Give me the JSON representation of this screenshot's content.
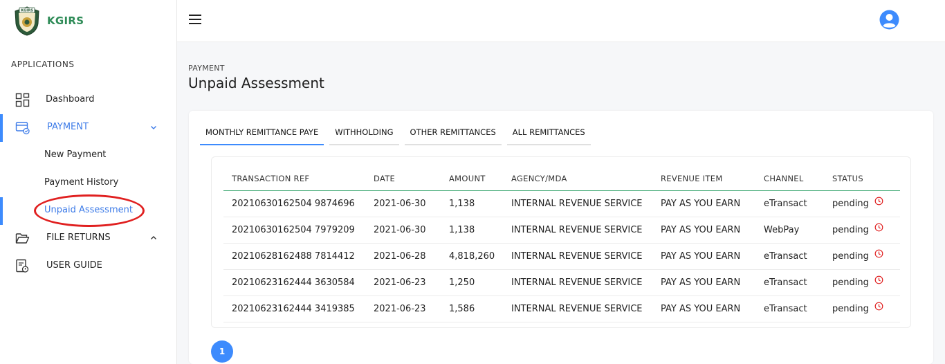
{
  "brand": {
    "name": "KGIRS",
    "logo_text": "KGIRS",
    "accent": "#2e8b57"
  },
  "sidebar": {
    "section_label": "APPLICATIONS",
    "items": [
      {
        "label": "Dashboard",
        "icon": "dashboard-grid-icon"
      },
      {
        "label": "PAYMENT",
        "icon": "payment-card-icon",
        "expanded": true
      },
      {
        "label": "FILE RETURNS",
        "icon": "folder-open-icon",
        "expanded": false
      },
      {
        "label": "USER GUIDE",
        "icon": "user-guide-icon"
      }
    ],
    "payment_sub": [
      {
        "label": "New Payment"
      },
      {
        "label": "Payment History"
      },
      {
        "label": "Unpaid Assessment",
        "active": true
      }
    ]
  },
  "header": {
    "menu_icon": "hamburger-icon",
    "avatar_icon": "user-avatar-icon"
  },
  "main": {
    "breadcrumb": "PAYMENT",
    "title": "Unpaid Assessment",
    "tabs": [
      {
        "label": "MONTHLY REMITTANCE PAYE",
        "active": true
      },
      {
        "label": "WITHHOLDING"
      },
      {
        "label": "OTHER REMITTANCES"
      },
      {
        "label": "ALL REMITTANCES"
      }
    ],
    "table": {
      "columns": [
        "TRANSACTION REF",
        "DATE",
        "AMOUNT",
        "AGENCY/MDA",
        "REVENUE ITEM",
        "CHANNEL",
        "STATUS"
      ],
      "rows": [
        [
          "20210630162504 9874696",
          "2021-06-30",
          "1,138",
          "INTERNAL REVENUE SERVICE",
          "PAY AS YOU EARN",
          "eTransact",
          "pending"
        ],
        [
          "20210630162504 7979209",
          "2021-06-30",
          "1,138",
          "INTERNAL REVENUE SERVICE",
          "PAY AS YOU EARN",
          "WebPay",
          "pending"
        ],
        [
          "20210628162488 7814412",
          "2021-06-28",
          "4,818,260",
          "INTERNAL REVENUE SERVICE",
          "PAY AS YOU EARN",
          "eTransact",
          "pending"
        ],
        [
          "20210623162444 3630584",
          "2021-06-23",
          "1,250",
          "INTERNAL REVENUE SERVICE",
          "PAY AS YOU EARN",
          "eTransact",
          "pending"
        ],
        [
          "20210623162444 3419385",
          "2021-06-23",
          "1,586",
          "INTERNAL REVENUE SERVICE",
          "PAY AS YOU EARN",
          "eTransact",
          "pending"
        ]
      ]
    },
    "pagination": {
      "current_page": "1"
    }
  },
  "colors": {
    "active_blue": "#3d8bfd",
    "status_icon": "#e02020",
    "highlight_ring": "#e02020"
  }
}
